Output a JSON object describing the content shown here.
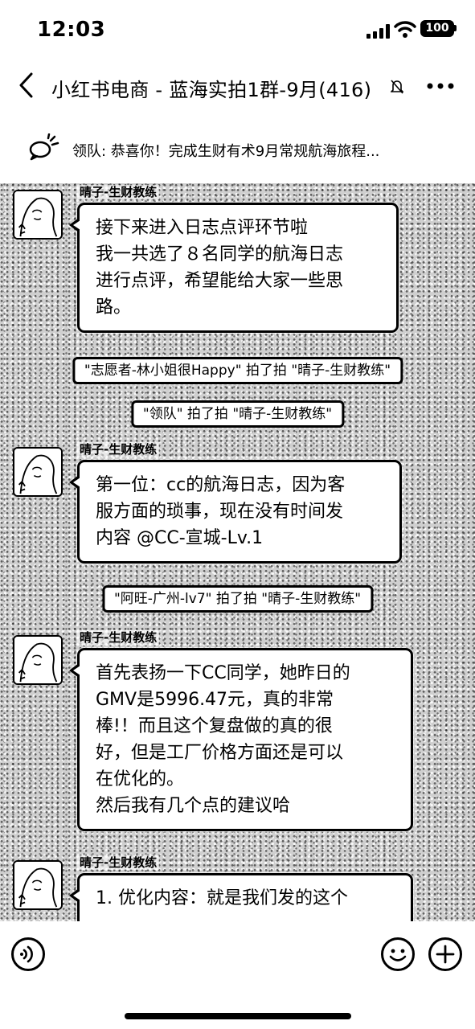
{
  "status_bar": {
    "time": "12:03",
    "battery": "100"
  },
  "header": {
    "title": "小红书电商 - 蓝海实拍1群-9月(416)"
  },
  "announcement": {
    "text": "领队: 恭喜你！完成生财有术9月常规航海旅程..."
  },
  "messages": [
    {
      "sender": "晴子-生财教练",
      "lines": [
        "接下来进入日志点评环节啦",
        "我一共选了８名同学的航海日志",
        "进行点评，希望能给大家一些思",
        "路。"
      ]
    },
    {
      "sender": "晴子-生财教练",
      "lines": [
        "第一位：cc的航海日志，因为客",
        "服方面的琐事，现在没有时间发",
        "内容 @CC-宣城-Lv.1"
      ]
    },
    {
      "sender": "晴子-生财教练",
      "lines": [
        "首先表扬一下CC同学，她昨日的",
        "GMV是5996.47元，真的非常",
        "棒!！而且这个复盘做的真的很",
        "好，但是工厂价格方面还是可以",
        "在优化的。",
        "然后我有几个点的建议哈"
      ]
    },
    {
      "sender": "晴子-生财教练",
      "lines": [
        "1. 优化内容：就是我们发的这个"
      ]
    }
  ],
  "system_messages": [
    "\"志愿者-林小姐很Happy\" 拍了拍 \"晴子-生财教练\"",
    "\"领队\" 拍了拍 \"晴子-生财教练\"",
    "\"阿旺-广州-lv7\" 拍了拍 \"晴子-生财教练\""
  ],
  "icons": {
    "back": "chevron-left-icon",
    "mute": "bell-muted-icon",
    "more": "more-dots-icon",
    "announce": "announcement-icon",
    "voice": "voice-icon",
    "emoji": "emoji-icon",
    "plus": "plus-icon"
  },
  "colors": {
    "bubble_bg": "#ffffff",
    "border": "#000000",
    "chat_bg": "#cfcfcf"
  }
}
